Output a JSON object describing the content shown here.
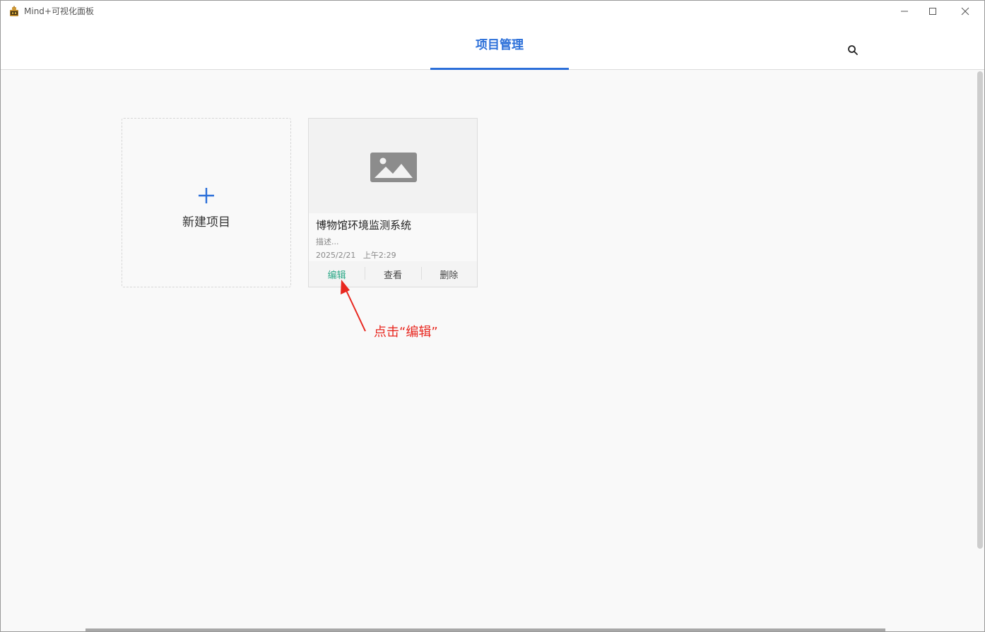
{
  "window": {
    "title": "Mind+可视化面板",
    "app_icon": "mind-plus-app-icon",
    "controls": [
      "minimize-icon",
      "maximize-icon",
      "close-icon"
    ]
  },
  "header": {
    "tab_label": "项目管理",
    "search_icon": "search-icon",
    "accent_color": "#2b6fd9"
  },
  "new_project": {
    "label": "新建项目",
    "icon": "plus-icon"
  },
  "project": {
    "thumbnail_icon": "image-placeholder-icon",
    "title": "博物馆环境监测系统",
    "description": "描述...",
    "date": "2025/2/21",
    "time": "上午2:29",
    "actions": {
      "edit": "编辑",
      "view": "查看",
      "delete": "删除"
    }
  },
  "annotation": {
    "text": "点击“编辑”",
    "color": "#e8271f"
  }
}
